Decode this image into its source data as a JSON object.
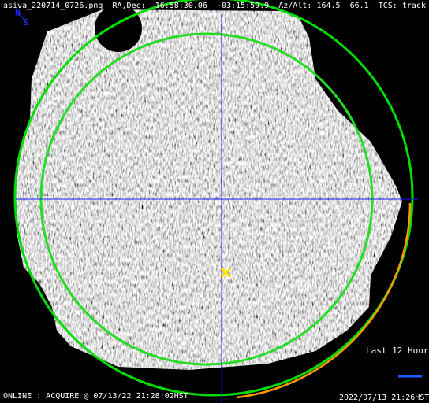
{
  "header": {
    "filename": "asiva_220714_0726.png",
    "radec_label": "RA,Dec:",
    "ra": "16:58:30.06",
    "dec": "-03:15:59.9",
    "azalt_label": "Az/Alt:",
    "az": "164.5",
    "alt": "66.1",
    "tcs_label": "TCS:",
    "tcs_mode": "track"
  },
  "compass": {
    "north": "N",
    "east": "E"
  },
  "history_label": "Last 12 Hours",
  "status_line": "ONLINE : ACQUIRE @ 07/13/22 21:28:02HST",
  "datetime": "2022/07/13 21:26HST",
  "colors": {
    "background": "#000000",
    "horizon_circle": "#00dd00",
    "altitude_circle": "#22dd22",
    "crosshair": "#1a1aff",
    "target_marker": "#ffe600",
    "track_arc": "#ff9900",
    "compass": "#1f2fff",
    "history_bar": "#1a5cff"
  },
  "icons": {
    "target": "target-x-icon"
  }
}
